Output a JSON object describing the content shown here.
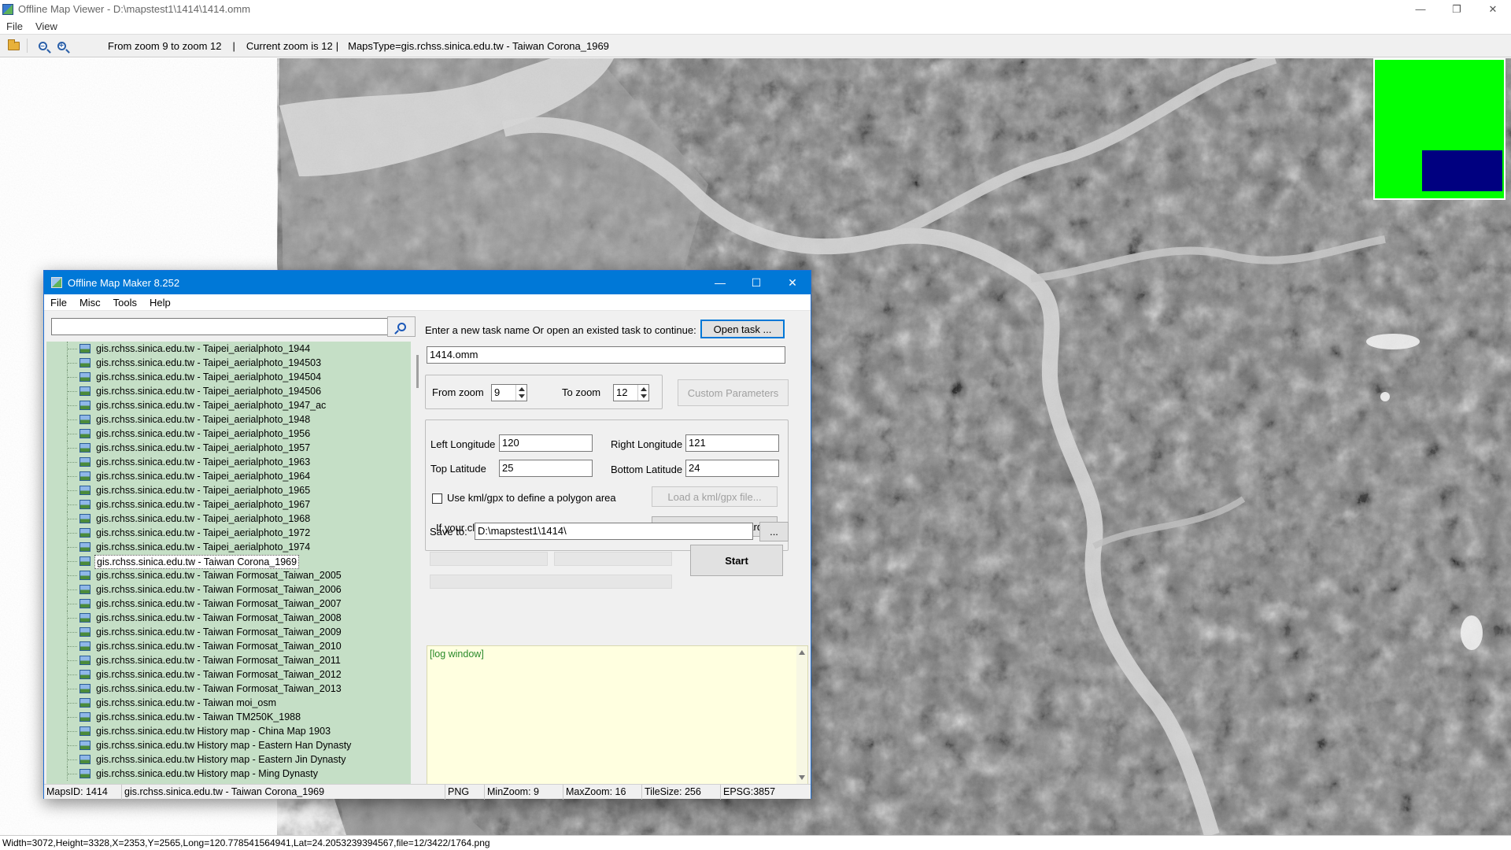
{
  "viewer": {
    "title": "Offline Map Viewer - D:\\mapstest1\\1414\\1414.omm",
    "menu": [
      "File",
      "View"
    ],
    "toolbar": {
      "zoom_range": "From zoom 9 to zoom 12",
      "separator1": "|",
      "current_zoom": "Current zoom is 12",
      "separator2": "|",
      "maps_type": "MapsType=gis.rchss.sinica.edu.tw - Taiwan Corona_1969"
    },
    "status": "Width=3072,Height=3328,X=2353,Y=2565,Long=120.778541564941,Lat=24.2053239394567,file=12/3422/1764.png",
    "minimap_colors": {
      "background": "#00ff00",
      "viewport": "#000080"
    }
  },
  "dialog": {
    "title": "Offline Map Maker 8.252",
    "menu": [
      "File",
      "Misc",
      "Tools",
      "Help"
    ],
    "search": {
      "value": ""
    },
    "tree_items": [
      "gis.rchss.sinica.edu.tw - Taipei_aerialphoto_1944",
      "gis.rchss.sinica.edu.tw - Taipei_aerialphoto_194503",
      "gis.rchss.sinica.edu.tw - Taipei_aerialphoto_194504",
      "gis.rchss.sinica.edu.tw - Taipei_aerialphoto_194506",
      "gis.rchss.sinica.edu.tw - Taipei_aerialphoto_1947_ac",
      "gis.rchss.sinica.edu.tw - Taipei_aerialphoto_1948",
      "gis.rchss.sinica.edu.tw - Taipei_aerialphoto_1956",
      "gis.rchss.sinica.edu.tw - Taipei_aerialphoto_1957",
      "gis.rchss.sinica.edu.tw - Taipei_aerialphoto_1963",
      "gis.rchss.sinica.edu.tw - Taipei_aerialphoto_1964",
      "gis.rchss.sinica.edu.tw - Taipei_aerialphoto_1965",
      "gis.rchss.sinica.edu.tw - Taipei_aerialphoto_1967",
      "gis.rchss.sinica.edu.tw - Taipei_aerialphoto_1968",
      "gis.rchss.sinica.edu.tw - Taipei_aerialphoto_1972",
      "gis.rchss.sinica.edu.tw - Taipei_aerialphoto_1974",
      "gis.rchss.sinica.edu.tw - Taiwan Corona_1969",
      "gis.rchss.sinica.edu.tw - Taiwan Formosat_Taiwan_2005",
      "gis.rchss.sinica.edu.tw - Taiwan Formosat_Taiwan_2006",
      "gis.rchss.sinica.edu.tw - Taiwan Formosat_Taiwan_2007",
      "gis.rchss.sinica.edu.tw - Taiwan Formosat_Taiwan_2008",
      "gis.rchss.sinica.edu.tw - Taiwan Formosat_Taiwan_2009",
      "gis.rchss.sinica.edu.tw - Taiwan Formosat_Taiwan_2010",
      "gis.rchss.sinica.edu.tw - Taiwan Formosat_Taiwan_2011",
      "gis.rchss.sinica.edu.tw - Taiwan Formosat_Taiwan_2012",
      "gis.rchss.sinica.edu.tw - Taiwan Formosat_Taiwan_2013",
      "gis.rchss.sinica.edu.tw - Taiwan moi_osm",
      "gis.rchss.sinica.edu.tw - Taiwan TM250K_1988",
      "gis.rchss.sinica.edu.tw History map - China Map 1903",
      "gis.rchss.sinica.edu.tw History map - Eastern Han Dynasty",
      "gis.rchss.sinica.edu.tw History map - Eastern Jin Dynasty",
      "gis.rchss.sinica.edu.tw History map - Ming Dynasty"
    ],
    "selected_index": 15,
    "task_prompt": "Enter a new task name Or open an existed task to continue:",
    "open_task_label": "Open task ...",
    "task_name": "1414.omm",
    "from_zoom_label": "From zoom",
    "from_zoom": "9",
    "to_zoom_label": "To zoom",
    "to_zoom": "12",
    "custom_params_label": "Custom Parameters",
    "left_lon_label": "Left Longitude",
    "left_lon": "120",
    "right_lon_label": "Right Longitude",
    "right_lon": "121",
    "top_lat_label": "Top Latitude",
    "top_lat": "25",
    "bottom_lat_label": "Bottom Latitude",
    "bottom_lat": "24",
    "kml_check_label": "Use kml/gpx to define a polygon area",
    "load_kml_label": "Load a kml/gpx file...",
    "clipboard_prompt": "If your clipboard contains coordinates values:",
    "paste_label": "Paste from Clipboard",
    "save_to_label": "Save to:",
    "save_to": "D:\\mapstest1\\1414\\",
    "browse_label": "...",
    "start_label": "Start",
    "log_text": "[log window]",
    "status": {
      "maps_id": "MapsID: 1414",
      "map_name": "gis.rchss.sinica.edu.tw - Taiwan Corona_1969",
      "format": "PNG",
      "min_zoom": "MinZoom: 9",
      "max_zoom": "MaxZoom: 16",
      "tile_size": "TileSize: 256",
      "epsg": "EPSG:3857"
    }
  }
}
